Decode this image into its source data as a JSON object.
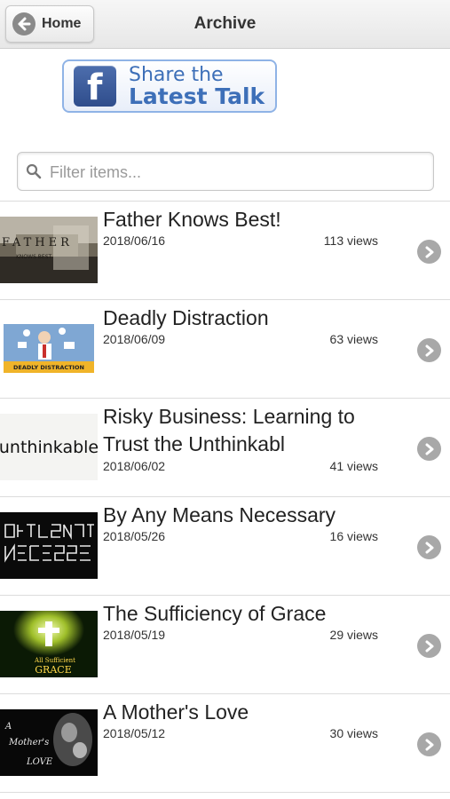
{
  "header": {
    "home_label": "Home",
    "title": "Archive"
  },
  "share": {
    "line1": "Share the",
    "line2": "Latest Talk",
    "brand_color": "#3b5998"
  },
  "search": {
    "placeholder": "Filter items...",
    "value": ""
  },
  "items": [
    {
      "title": "Father Knows Best!",
      "date": "2018/06/16",
      "views": "113 views",
      "thumb_icon": "father-knows-best-thumbnail"
    },
    {
      "title": "Deadly Distraction",
      "date": "2018/06/09",
      "views": "63 views",
      "thumb_icon": "deadly-distraction-thumbnail",
      "thumb_caption": "DEADLY DISTRACTION"
    },
    {
      "title": "Risky Business: Learning to Trust the Unthinkabl",
      "date": "2018/06/02",
      "views": "41 views",
      "thumb_icon": "unthinkable-thumbnail",
      "thumb_text": "unthinkable"
    },
    {
      "title": "By Any Means Necessary",
      "date": "2018/05/26",
      "views": "16 views",
      "thumb_icon": "by-any-means-necessary-thumbnail"
    },
    {
      "title": "The Sufficiency of Grace",
      "date": "2018/05/19",
      "views": "29 views",
      "thumb_icon": "sufficiency-of-grace-thumbnail"
    },
    {
      "title": "A Mother's Love",
      "date": "2018/05/12",
      "views": "30 views",
      "thumb_icon": "mothers-love-thumbnail"
    }
  ]
}
